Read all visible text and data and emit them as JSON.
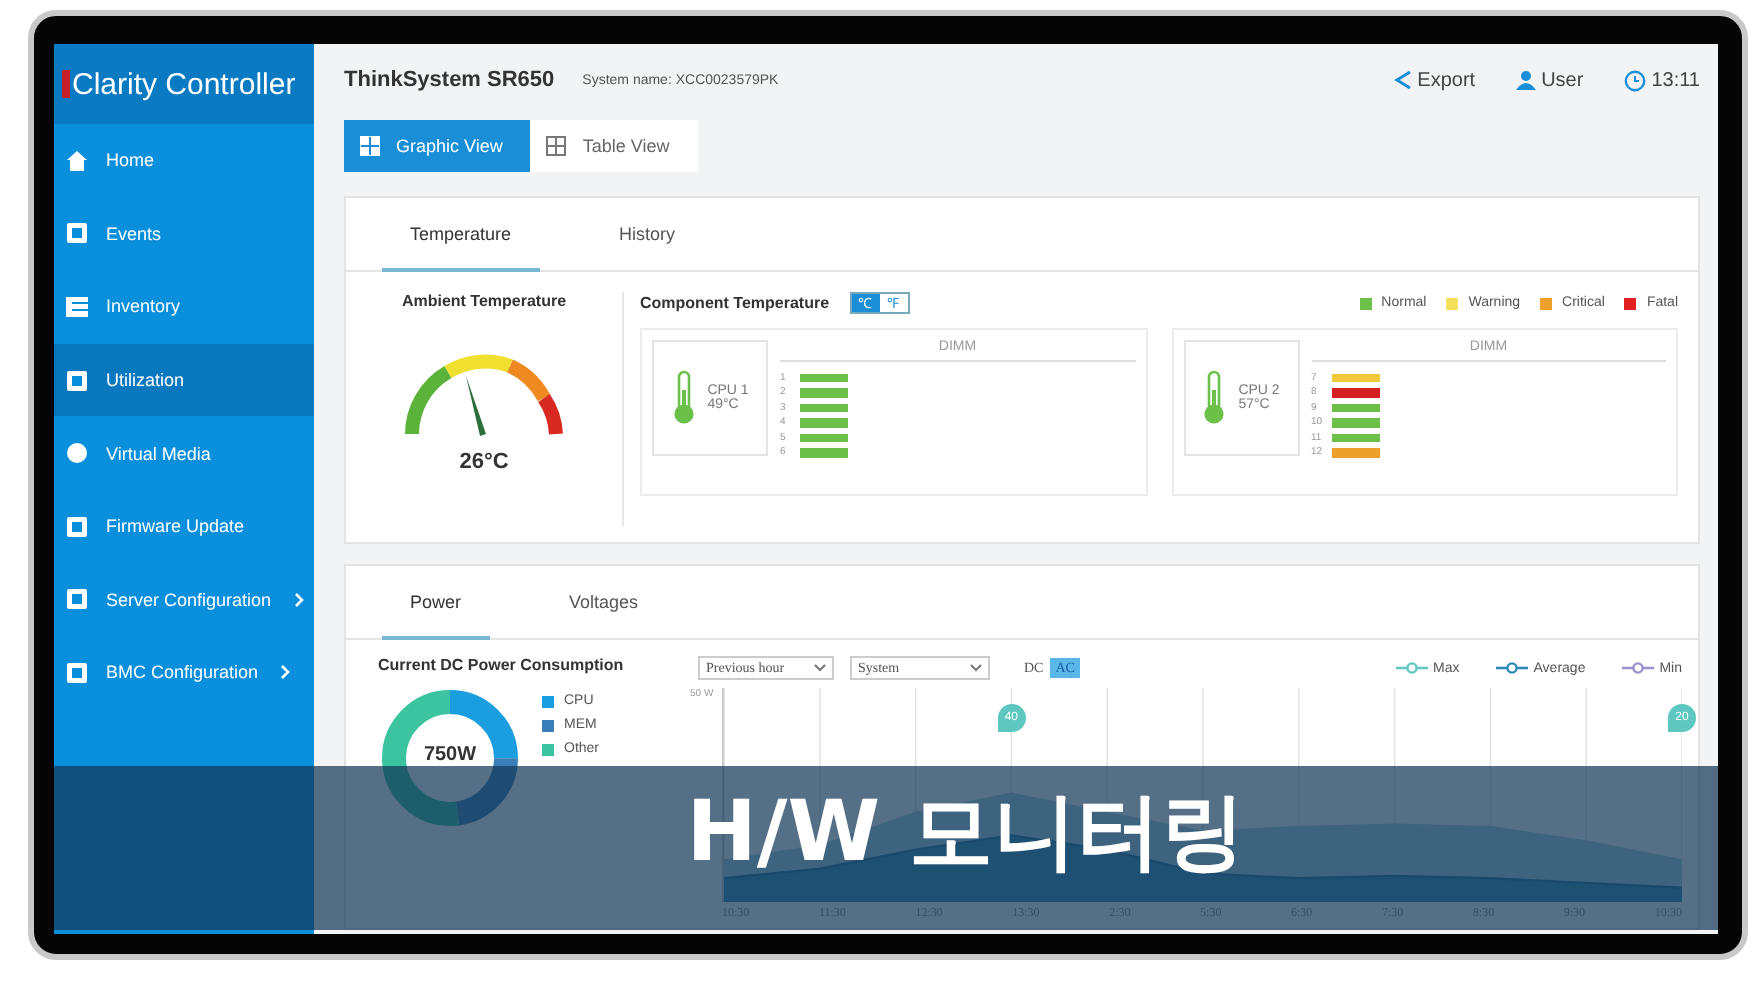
{
  "sidebar": {
    "brand": "Clarity Controller",
    "items": [
      {
        "label": "Home",
        "selected": false,
        "has_submenu": false
      },
      {
        "label": "Events",
        "selected": false,
        "has_submenu": false
      },
      {
        "label": "Inventory",
        "selected": false,
        "has_submenu": false
      },
      {
        "label": "Utilization",
        "selected": true,
        "has_submenu": false
      },
      {
        "label": "Virtual Media",
        "selected": false,
        "has_submenu": false
      },
      {
        "label": "Firmware Update",
        "selected": false,
        "has_submenu": false
      },
      {
        "label": "Server Configuration",
        "selected": false,
        "has_submenu": true
      },
      {
        "label": "BMC Configuration",
        "selected": false,
        "has_submenu": true
      }
    ]
  },
  "header": {
    "title": "ThinkSystem SR650",
    "system_name": "System name: XCC0023579PK",
    "actions": [
      {
        "kind": "share",
        "label": "Export"
      },
      {
        "kind": "user",
        "label": "User"
      },
      {
        "kind": "clock",
        "label": "13:11"
      }
    ]
  },
  "views": [
    {
      "label": "Graphic View",
      "selected": true
    },
    {
      "label": "Table View",
      "selected": false
    }
  ],
  "temperature_card": {
    "tabs": [
      {
        "label": "Temperature",
        "selected": true
      },
      {
        "label": "History",
        "selected": false
      }
    ],
    "ambient": {
      "title": "Ambient Temperature",
      "reading": "26°C"
    },
    "component": {
      "title": "Component Temperature",
      "units": [
        {
          "label": "℃",
          "selected": true
        },
        {
          "label": "℉",
          "selected": false
        }
      ],
      "legend": [
        {
          "label": "Normal",
          "color": "#6cc04a"
        },
        {
          "label": "Warning",
          "color": "#f5e05a"
        },
        {
          "label": "Critical",
          "color": "#eea12a"
        },
        {
          "label": "Fatal",
          "color": "#e02020"
        }
      ],
      "cpus": [
        {
          "name": "CPU 1",
          "reading": "49°C",
          "heading": "DIMM",
          "dimms": [
            {
              "label": "1",
              "color": "#6cc04a"
            },
            {
              "label": "2",
              "color": "#6cc04a"
            },
            {
              "label": "3",
              "color": "#6cc04a"
            },
            {
              "label": "4",
              "color": "#6cc04a"
            },
            {
              "label": "5",
              "color": "#6cc04a"
            },
            {
              "label": "6",
              "color": "#6cc04a"
            }
          ]
        },
        {
          "name": "CPU 2",
          "reading": "57°C",
          "heading": "DIMM",
          "dimms": [
            {
              "label": "7",
              "color": "#f0c93a"
            },
            {
              "label": "8",
              "color": "#d42020"
            },
            {
              "label": "9",
              "color": "#6cc04a"
            },
            {
              "label": "10",
              "color": "#6cc04a"
            },
            {
              "label": "11",
              "color": "#6cc04a"
            },
            {
              "label": "12",
              "color": "#eea12a"
            }
          ]
        }
      ]
    }
  },
  "power_card": {
    "tabs": [
      {
        "label": "Power",
        "selected": true
      },
      {
        "label": "Voltages",
        "selected": false
      }
    ],
    "title": "Current DC Power Consumption",
    "period_select": {
      "value": "Previous hour"
    },
    "scope_select": {
      "value": "System"
    },
    "modes": [
      {
        "label": "DC",
        "selected": false
      },
      {
        "label": "AC",
        "selected": true
      }
    ],
    "series_legend": [
      {
        "label": "Max",
        "color": "#5ec8c0"
      },
      {
        "label": "Average",
        "color": "#2a8ab8"
      },
      {
        "label": "Min",
        "color": "#9a8fd0"
      }
    ],
    "donut": {
      "total": "750W",
      "segments": [
        {
          "label": "CPU",
          "color": "#1a9ee0"
        },
        {
          "label": "MEM",
          "color": "#3a7fb8"
        },
        {
          "label": "Other",
          "color": "#3cc3a0"
        }
      ]
    },
    "chart": {
      "y_unit": "50 W",
      "pins": [
        "40",
        "20"
      ],
      "x_labels": [
        "10:30",
        "11:30",
        "12:30",
        "13:30",
        "2:30",
        "5:30",
        "6:30",
        "7:30",
        "8:30",
        "9:30",
        "10:30"
      ]
    }
  },
  "banner": {
    "title": "H/W 모니터링"
  }
}
